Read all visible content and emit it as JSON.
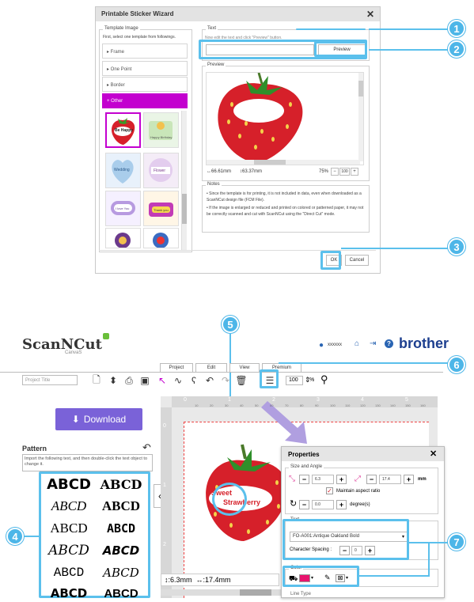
{
  "wizard": {
    "title": "Printable Sticker Wizard",
    "template_legend": "Template Image",
    "template_hint": "First, select one template from followings.",
    "categories": [
      "▸ Frame",
      "▸ One Point",
      "▸ Border",
      "+ Other"
    ],
    "thumb_labels": [
      "Be Happy",
      "Happy Birthday",
      "Wedding",
      "Flower",
      "I love You",
      "Thank you"
    ],
    "text_legend": "Text",
    "text_hint": "Now edit the text and click \"Preview\" button.",
    "text_value": "",
    "preview_button": "Preview",
    "preview_legend": "Preview",
    "width_readout": "↔66.61mm",
    "height_readout": "↕63.37mm",
    "zoom_readout": "75%",
    "zoom_field": "100",
    "notes_legend": "Notes",
    "notes": [
      "Since the template is for printing, it is not included in data, even when downloaded as a ScanNCut design file (FCM File).",
      "If the image is enlarged or reduced and printed on colored or patterned paper, it may not be correctly scanned and cut with ScanNCut using the \"Direct Cut\" mode."
    ],
    "ok_button": "OK",
    "cancel_button": "Cancel"
  },
  "callouts": [
    "1",
    "2",
    "3",
    "4",
    "5",
    "6",
    "7"
  ],
  "app": {
    "logo": "ScanNCut",
    "logo_sub": "CanvaS",
    "user": "xxxxxx",
    "brand": "brother",
    "tabs": [
      "Project",
      "Edit",
      "View",
      "Premium"
    ],
    "project_title_placeholder": "Project Title",
    "zoom_value": "100",
    "zoom_unit": "%",
    "download_button": "Download",
    "pattern_heading": "Pattern",
    "pattern_hint": "Import the following text, and then double-click the text object to change it.",
    "ruler_top": [
      "0",
      "1",
      "2",
      "3",
      "4",
      "5",
      "6"
    ],
    "ruler_minor": [
      "10",
      "20",
      "30",
      "40",
      "50",
      "60",
      "70",
      "80",
      "90",
      "100",
      "110",
      "120",
      "130",
      "140",
      "150",
      "160"
    ],
    "ruler_left": [
      "0",
      "1",
      "2"
    ],
    "canvas_text_1": "Sweet",
    "canvas_text_2": "Strawberry",
    "readout_height": "↕:6.3mm",
    "readout_width": "↔:17.4mm"
  },
  "patterns": [
    "ABCD",
    "ABCD",
    "ABCD",
    "ABCD",
    "ABCD",
    "ABCD",
    "ABCD",
    "ABCD",
    "ABCD",
    "ABCD",
    "ABCD",
    "ABCD"
  ],
  "properties": {
    "title": "Properties",
    "size_legend": "Size and Angle",
    "height_value": "6.3",
    "width_value": "17.4",
    "unit": "mm",
    "aspect_label": "Maintain aspect ratio",
    "angle_value": "0.0",
    "angle_unit": "degree(s)",
    "text_legend": "Text",
    "font_value": "FO-A001:Antique Oakland Bold",
    "spacing_label": "Character Spacing :",
    "spacing_value": "0",
    "color_legend": "Color",
    "fill_color": "#e8146e",
    "line_type_legend": "Line Type",
    "minus": "−",
    "plus": "+"
  }
}
